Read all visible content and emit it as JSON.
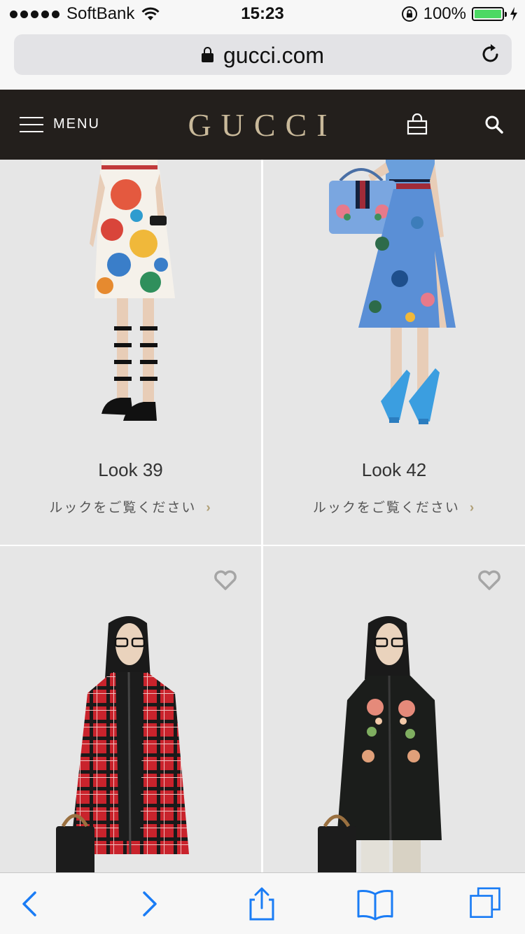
{
  "status_bar": {
    "carrier": "SoftBank",
    "time": "15:23",
    "battery": "100%",
    "battery_level": 1.0
  },
  "browser": {
    "url": "gucci.com"
  },
  "header": {
    "menu_label": "MENU",
    "logo": "GUCCI"
  },
  "looks": [
    {
      "title": "Look 39",
      "link": "ルックをご覧ください"
    },
    {
      "title": "Look 42",
      "link": "ルックをご覧ください"
    }
  ],
  "colors": {
    "header_bg": "#231f1c",
    "logo": "#c9b99a",
    "card_bg": "#e6e6e6",
    "ios_blue": "#1a7cf5"
  },
  "icons": {
    "toolbar": [
      "back-icon",
      "forward-icon",
      "share-icon",
      "bookmarks-icon",
      "tabs-icon"
    ],
    "header": [
      "hamburger-icon",
      "shopping-bag-icon",
      "search-icon"
    ]
  }
}
